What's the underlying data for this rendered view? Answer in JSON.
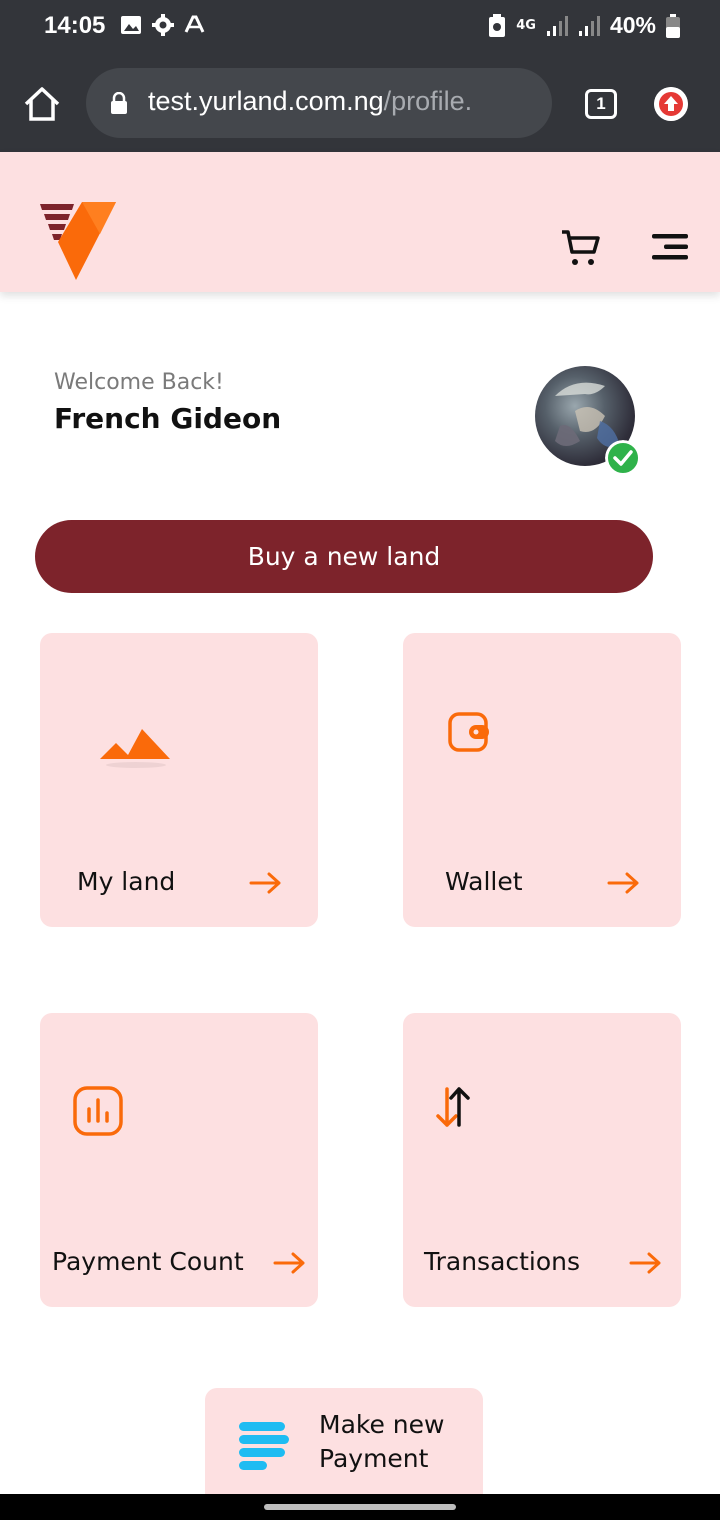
{
  "status_bar": {
    "time": "14:05",
    "network": "4G",
    "battery": "40%",
    "icons_left": [
      "image-icon",
      "gear-icon",
      "font-icon"
    ],
    "icons_right": [
      "battery-saver-icon",
      "signal-icon",
      "signal-icon",
      "battery-icon"
    ]
  },
  "browser": {
    "url_host": "test.yurland.com.ng",
    "url_path": "/profile.",
    "tab_count": "1"
  },
  "user": {
    "welcome": "Welcome Back!",
    "name": "French Gideon"
  },
  "actions": {
    "buy_label": "Buy a new land"
  },
  "cards": [
    {
      "label": "My land",
      "icon": "mountain-icon"
    },
    {
      "label": "Wallet",
      "icon": "wallet-icon"
    },
    {
      "label": "Payment Count",
      "icon": "bar-chart-icon"
    },
    {
      "label": "Transactions",
      "icon": "transfer-arrows-icon"
    }
  ],
  "payment": {
    "label": "Make new Payment",
    "icon": "stack-icon"
  },
  "colors": {
    "brand_primary": "#7d232b",
    "accent": "#fa6a0a",
    "card_bg": "#fde0e1",
    "payment_icon": "#1ebcf2",
    "verified": "#2fb24a"
  }
}
